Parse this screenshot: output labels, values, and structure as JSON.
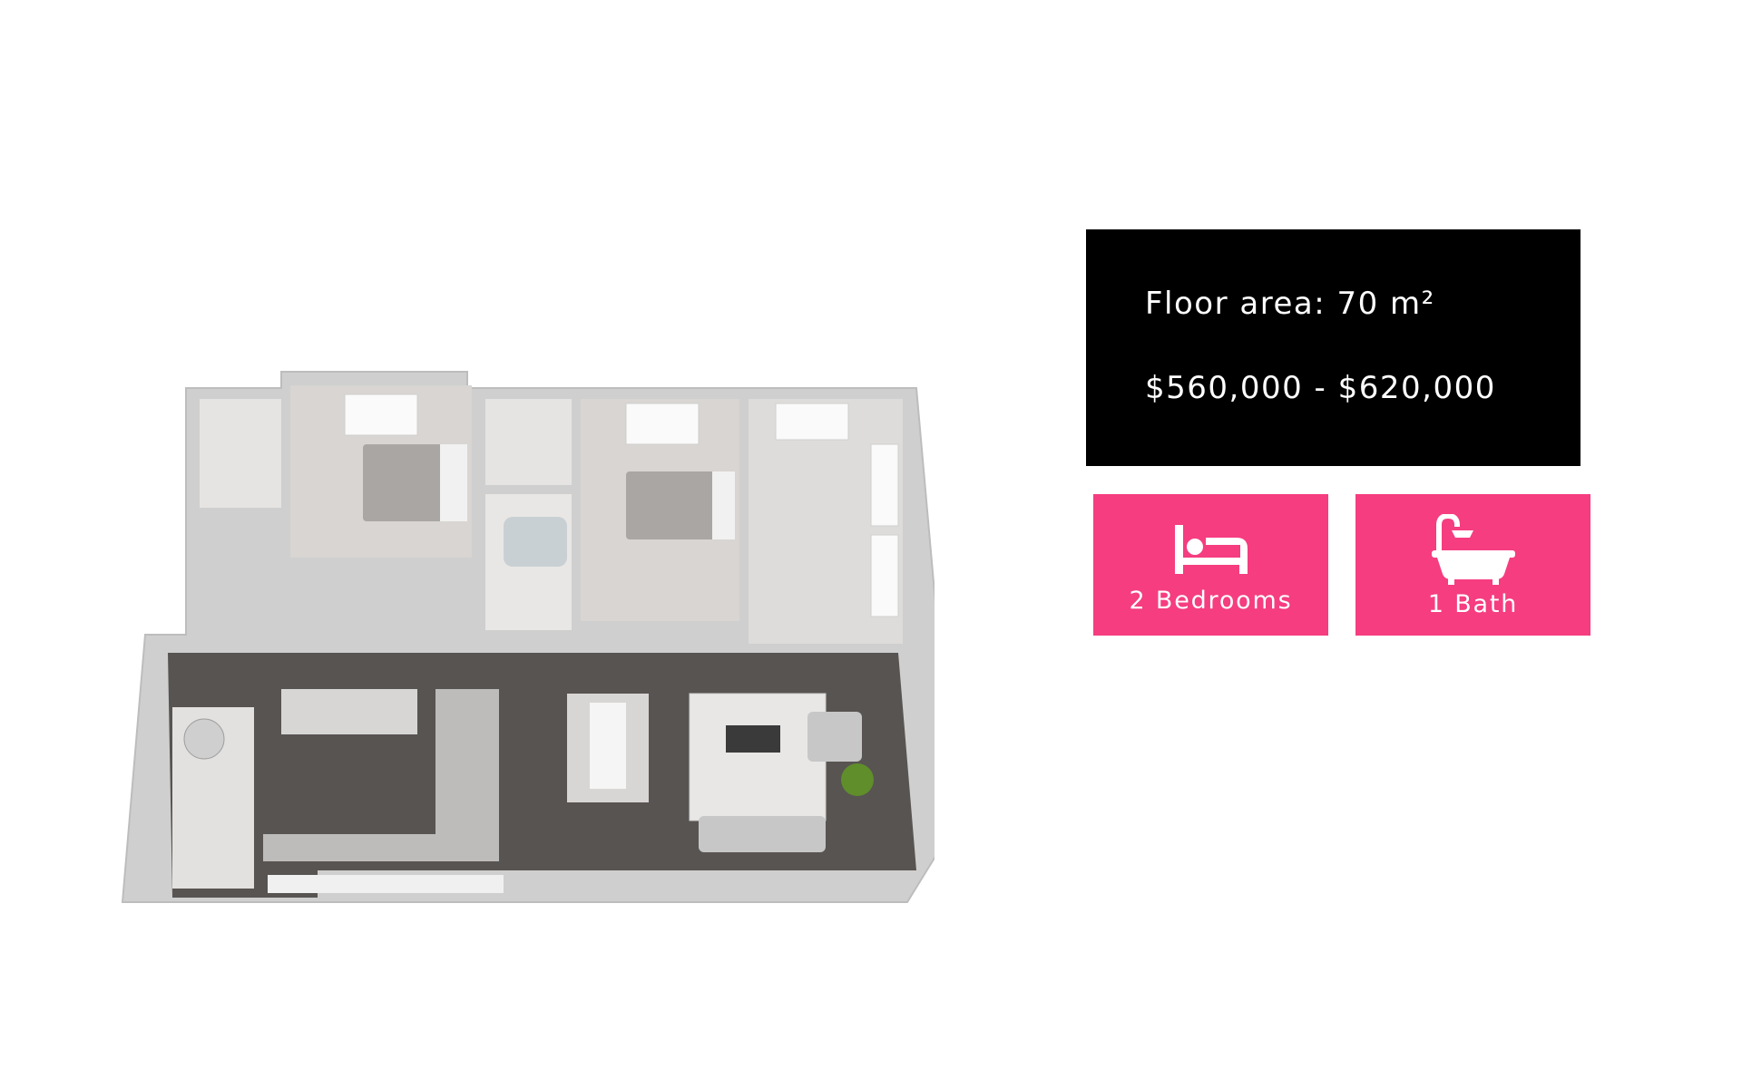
{
  "listing": {
    "floor_area": "Floor area: 70 m²",
    "price_range": "$560,000 - $620,000"
  },
  "features": {
    "bedrooms": {
      "label": "2 Bedrooms",
      "icon": "bed-icon"
    },
    "bathrooms": {
      "label": "1 Bath",
      "icon": "bathtub-shower-icon"
    }
  },
  "colors": {
    "info_background": "#000000",
    "accent": "#f53d80",
    "text": "#ffffff"
  }
}
